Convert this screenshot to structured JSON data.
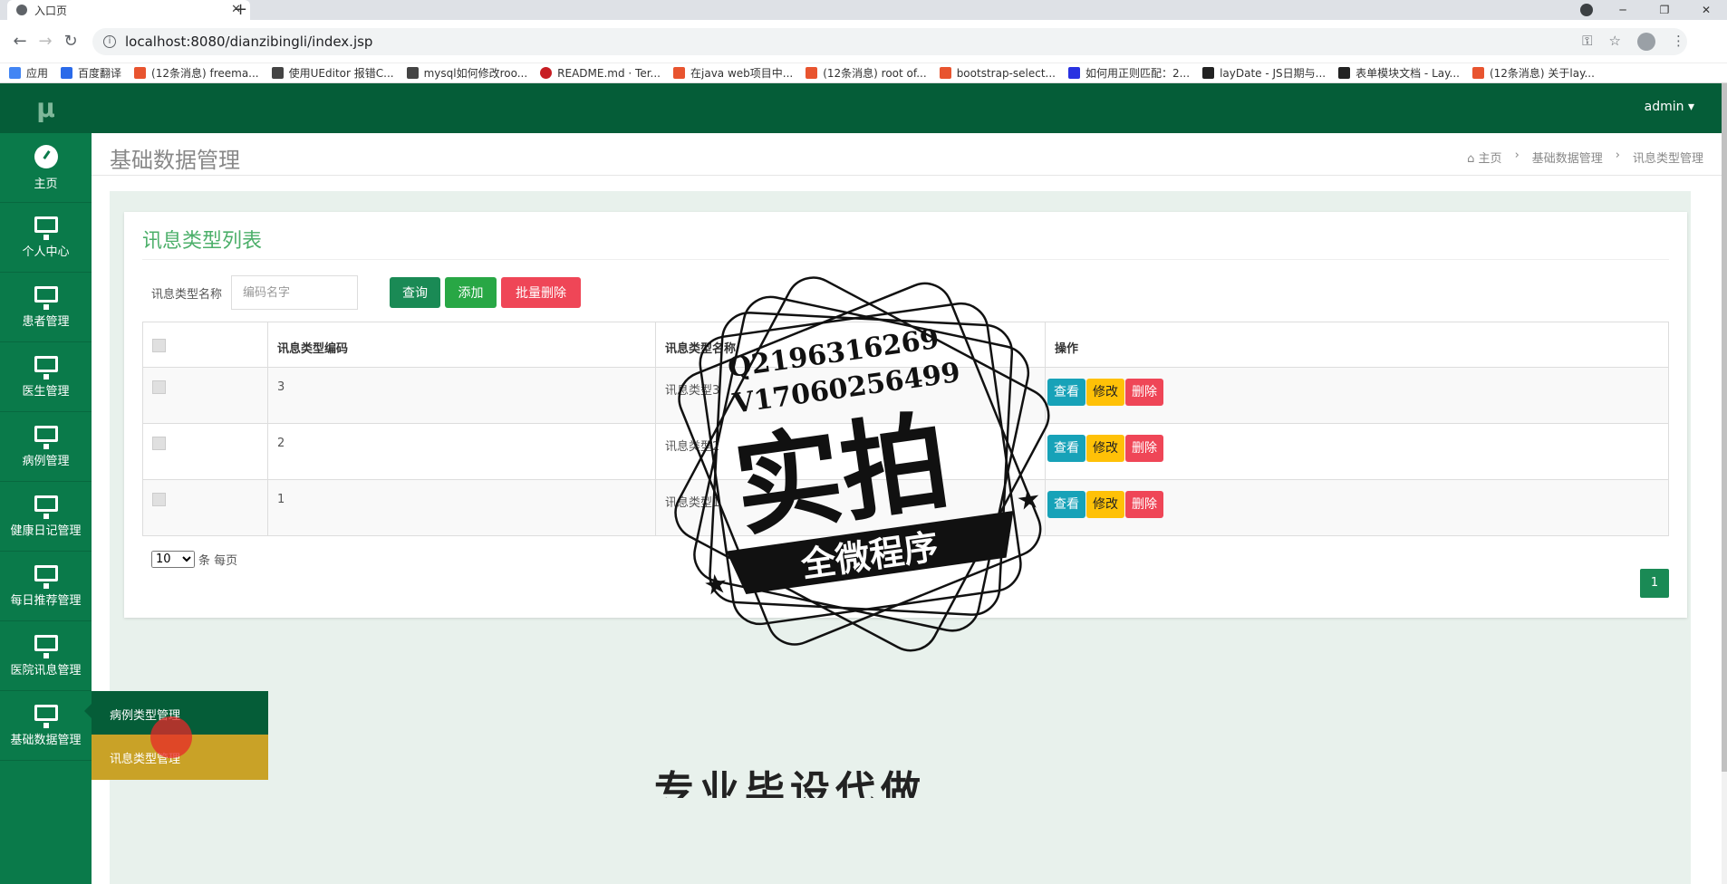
{
  "browser": {
    "tab_title": "入口页",
    "url": "localhost:8080/dianzibingli/index.jsp",
    "bookmarks": [
      {
        "label": "应用",
        "color": "#4285f4"
      },
      {
        "label": "百度翻译",
        "color": "#2a6ae9"
      },
      {
        "label": "(12条消息) freema...",
        "color": "#e8542f"
      },
      {
        "label": "使用UEditor 报错C...",
        "color": "#444444"
      },
      {
        "label": "mysql如何修改roo...",
        "color": "#444444"
      },
      {
        "label": "README.md · Ter...",
        "color": "#c71d23"
      },
      {
        "label": "在java web项目中...",
        "color": "#e8542f"
      },
      {
        "label": "(12条消息) root of...",
        "color": "#e8542f"
      },
      {
        "label": "bootstrap-select...",
        "color": "#e8542f"
      },
      {
        "label": "如何用正则匹配：2...",
        "color": "#2932e1"
      },
      {
        "label": "layDate - JS日期与...",
        "color": "#222222"
      },
      {
        "label": "表单模块文档 - Lay...",
        "color": "#222222"
      },
      {
        "label": "(12条消息) 关于lay...",
        "color": "#e8542f"
      }
    ]
  },
  "sidebar": {
    "logo": "μ",
    "items": [
      {
        "label": "主页",
        "icon": "dashboard-icon"
      },
      {
        "label": "个人中心",
        "icon": "monitor-icon"
      },
      {
        "label": "患者管理",
        "icon": "monitor-icon"
      },
      {
        "label": "医生管理",
        "icon": "monitor-icon"
      },
      {
        "label": "病例管理",
        "icon": "monitor-icon"
      },
      {
        "label": "健康日记管理",
        "icon": "monitor-icon"
      },
      {
        "label": "每日推荐管理",
        "icon": "monitor-icon"
      },
      {
        "label": "医院讯息管理",
        "icon": "monitor-icon"
      },
      {
        "label": "基础数据管理",
        "icon": "monitor-icon"
      }
    ],
    "submenu": [
      "病例类型管理",
      "讯息类型管理"
    ]
  },
  "topbar": {
    "user": "admin ▾"
  },
  "pagehead": {
    "title": "基础数据管理",
    "breadcrumb": [
      "主页",
      "基础数据管理",
      "讯息类型管理"
    ]
  },
  "panel": {
    "title": "讯息类型列表",
    "search_label": "讯息类型名称",
    "search_placeholder": "编码名字",
    "btn_query": "查询",
    "btn_add": "添加",
    "btn_batch_delete": "批量删除",
    "columns": [
      "讯息类型编码",
      "讯息类型名称",
      "操作"
    ],
    "rows": [
      {
        "code": "3",
        "name": "讯息类型3"
      },
      {
        "code": "2",
        "name": "讯息类型2"
      },
      {
        "code": "1",
        "name": "讯息类型1"
      }
    ],
    "actions": {
      "view": "查看",
      "edit": "修改",
      "delete": "删除"
    },
    "page_size": "10",
    "page_size_suffix": "条 每页",
    "current_page": "1"
  },
  "watermark": {
    "line1": "Q2196316269",
    "line2": "V17060256499",
    "main": "实拍",
    "ribbon": "全微程序"
  },
  "bottom_text": "专业毕设代做"
}
